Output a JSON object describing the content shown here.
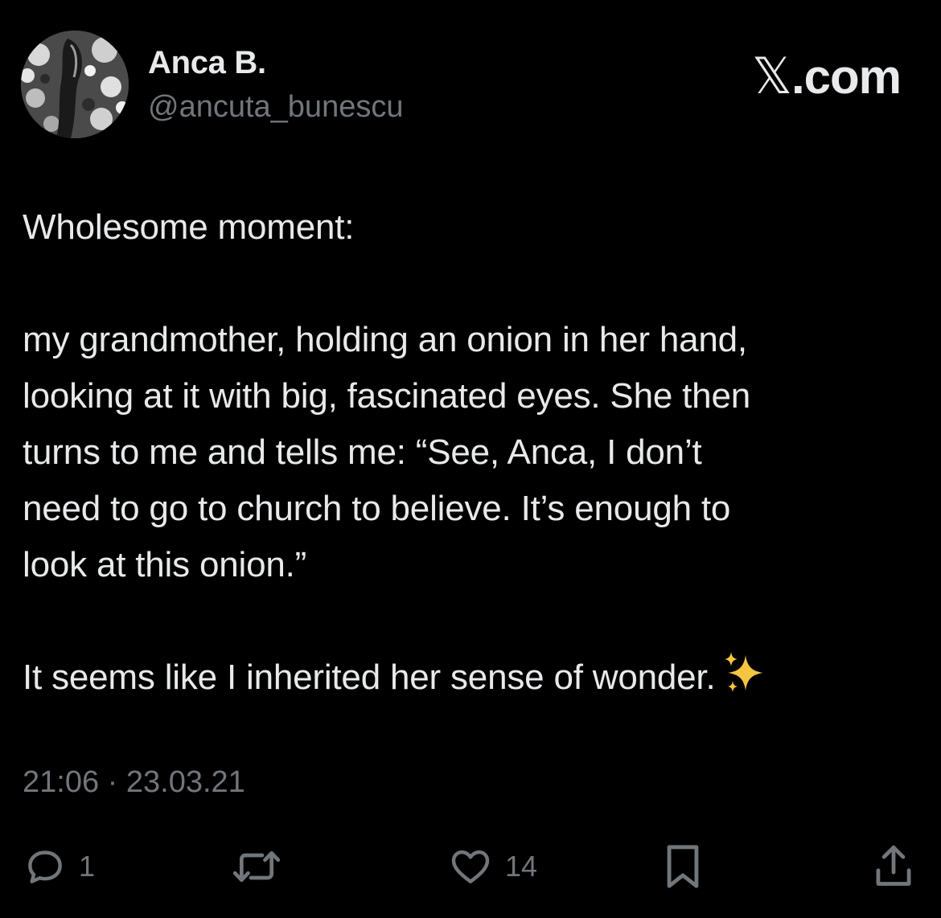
{
  "author": {
    "name": "Anca B.",
    "handle": "@ancuta_bunescu"
  },
  "brand": {
    "glyph": "𝕏",
    "suffix": ".com"
  },
  "tweet": {
    "paragraphs": [
      "Wholesome moment:",
      "my grandmother, holding an onion in her hand,\nlooking at it with big, fascinated eyes. She then\nturns to me and tells me: “See, Anca, I don’t\nneed to go to church to believe. It’s enough to\nlook at this onion.”",
      "It seems like I inherited her sense of wonder."
    ],
    "emoji": "sparkles-icon",
    "timestamp": "21:06 · 23.03.21"
  },
  "actions": {
    "reply_count": "1",
    "retweet_count": "",
    "like_count": "14",
    "icons": [
      "reply-icon",
      "retweet-icon",
      "like-icon",
      "bookmark-icon",
      "share-icon"
    ]
  },
  "colors": {
    "background": "#000000",
    "primary_text": "#e7e9ea",
    "secondary_text": "#71767b",
    "sparkle": "#f5c542"
  }
}
